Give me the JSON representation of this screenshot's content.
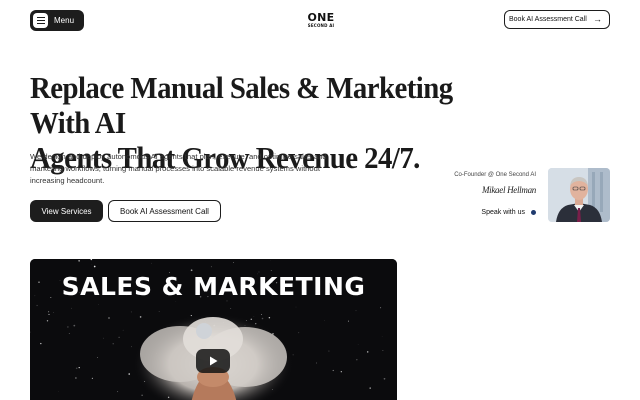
{
  "header": {
    "menu_label": "Menu",
    "menu_icon": "hamburger-icon",
    "logo_main": "ONE",
    "logo_sub": "SECOND AI",
    "cta_label": "Book AI Assessment Call",
    "cta_icon": "arrow-right-icon"
  },
  "hero": {
    "title_line1": "Replace Manual Sales & Marketing With AI",
    "title_line2": "Agents That Grow Revenue 24/7.",
    "description": "We design and deploy autonomous AI agents that plan, execute, and optimize sales and marketing workflows, turning manual processes into scalable revenue systems without increasing headcount.",
    "primary_button": "View Services",
    "secondary_button": "Book AI Assessment Call"
  },
  "founder": {
    "role": "Co-Founder @ One Second AI",
    "signature": "Mikael Hellman",
    "speak_label": "Speak with us",
    "dot_color": "#1f3a6e"
  },
  "video": {
    "title": "SALES & MARKETING",
    "play_icon": "play-icon"
  },
  "colors": {
    "dark": "#1d1d1d",
    "background": "#ffffff"
  }
}
